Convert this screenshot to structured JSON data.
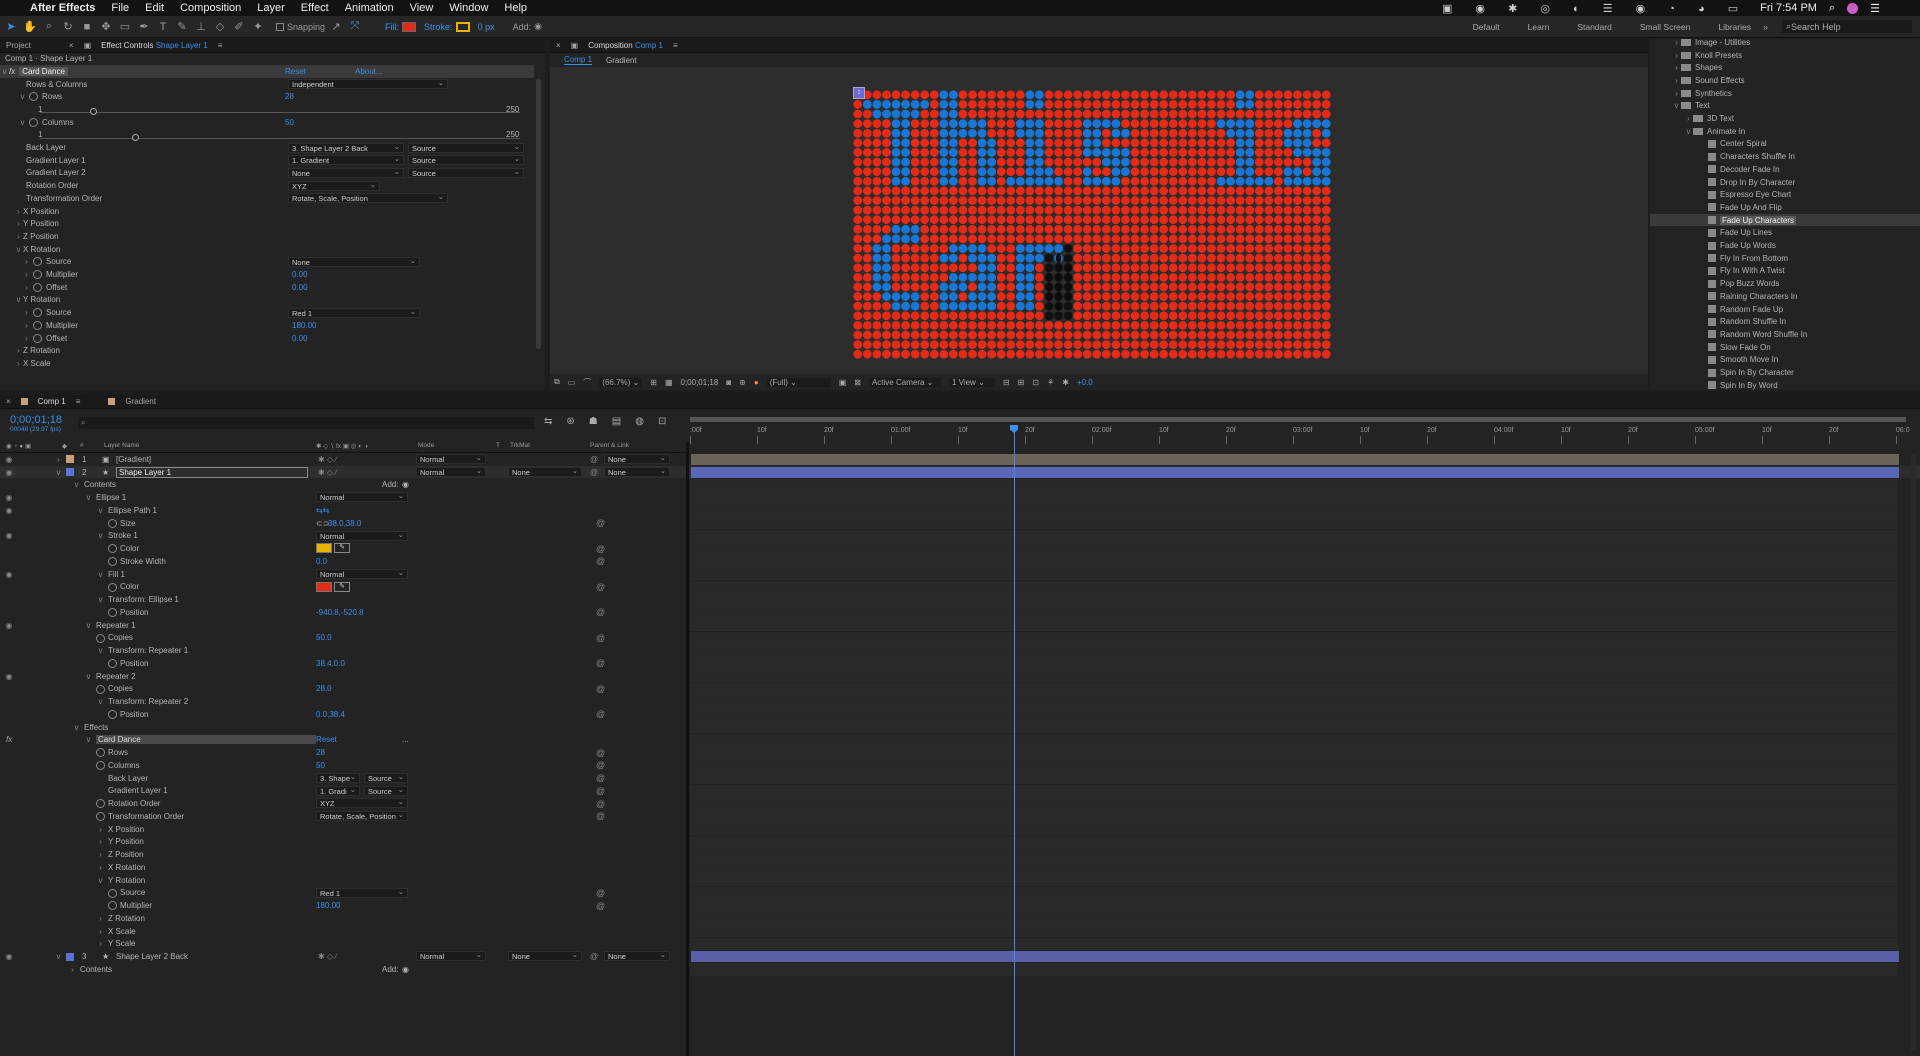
{
  "menubar": {
    "apple": "",
    "app": "After Effects",
    "items": [
      "File",
      "Edit",
      "Composition",
      "Layer",
      "Effect",
      "Animation",
      "View",
      "Window",
      "Help"
    ],
    "clock": "Fri 7:54 PM"
  },
  "toolbar": {
    "snapping": "Snapping",
    "fill": "Fill:",
    "stroke": "Stroke:",
    "stroke_px": "0 px",
    "add": "Add:",
    "fill_color": "#e52a18",
    "stroke_color": "#e8b400",
    "workspaces": [
      "Default",
      "Learn",
      "Standard",
      "Small Screen",
      "Libraries"
    ],
    "search": "Search Help"
  },
  "effect_panel": {
    "tab_project": "Project",
    "tab_effect": "Effect Controls",
    "tab_layer": "Shape Layer 1",
    "breadcrumb": "Comp 1 · Shape Layer 1",
    "effect_name": "Card Dance",
    "reset": "Reset",
    "about": "About...",
    "rows": [
      {
        "label": "Rows & Columns",
        "val": "Independent",
        "type": "dd"
      },
      {
        "label": "Rows",
        "val": "28",
        "type": "num",
        "tw": 1
      },
      {
        "label": "1",
        "val": "250",
        "type": "range"
      },
      {
        "label": "Columns",
        "val": "50",
        "type": "num",
        "tw": 1
      },
      {
        "label": "1",
        "val": "250",
        "type": "range2"
      },
      {
        "label": "Back Layer",
        "val": "3. Shape Layer 2 Back",
        "val2": "Source",
        "type": "dd2"
      },
      {
        "label": "Gradient Layer 1",
        "val": "1. Gradient",
        "val2": "Source",
        "type": "dd2"
      },
      {
        "label": "Gradient Layer 2",
        "val": "None",
        "val2": "Source",
        "type": "dd2"
      },
      {
        "label": "Rotation Order",
        "val": "XYZ",
        "type": "dds"
      },
      {
        "label": "Transformation Order",
        "val": "Rotate, Scale, Position",
        "type": "dd"
      },
      {
        "label": "X Position",
        "type": "grp"
      },
      {
        "label": "Y Position",
        "type": "grp"
      },
      {
        "label": "Z Position",
        "type": "grp"
      },
      {
        "label": "X Rotation",
        "type": "grpo"
      },
      {
        "label": "Source",
        "val": "None",
        "type": "ddi"
      },
      {
        "label": "Multiplier",
        "val": "0.00",
        "type": "numi"
      },
      {
        "label": "Offset",
        "val": "0.00",
        "type": "numi"
      },
      {
        "label": "Y Rotation",
        "type": "grpo"
      },
      {
        "label": "Source",
        "val": "Red 1",
        "type": "ddi"
      },
      {
        "label": "Multiplier",
        "val": "180.00",
        "type": "numi"
      },
      {
        "label": "Offset",
        "val": "0.00",
        "type": "numi"
      },
      {
        "label": "Z Rotation",
        "type": "grp"
      },
      {
        "label": "X Scale",
        "type": "grp"
      }
    ]
  },
  "comp_panel": {
    "title": "Composition",
    "comp": "Comp 1",
    "tab1": "Comp 1",
    "tab2": "Gradient",
    "text_line1": "This is a",
    "text_line2": "Car",
    "zoom": "(66.7%)",
    "time": "0;00;01;18",
    "res": "(Full)",
    "camera": "Active Camera",
    "view": "1 View",
    "exposure": "+0.0",
    "bg_dot": "#e52a18",
    "text_dot": "#1877d6"
  },
  "effects_panel": {
    "items": [
      {
        "label": "Image - Utilities",
        "lvl": 1,
        "kind": "folder"
      },
      {
        "label": "Knoll Presets",
        "lvl": 1,
        "kind": "folder"
      },
      {
        "label": "Shapes",
        "lvl": 1,
        "kind": "folder"
      },
      {
        "label": "Sound Effects",
        "lvl": 1,
        "kind": "folder"
      },
      {
        "label": "Synthetics",
        "lvl": 1,
        "kind": "folder"
      },
      {
        "label": "Text",
        "lvl": 1,
        "kind": "folder-open"
      },
      {
        "label": "3D Text",
        "lvl": 2,
        "kind": "folder"
      },
      {
        "label": "Animate In",
        "lvl": 2,
        "kind": "folder-open"
      },
      {
        "label": "Center Spiral",
        "lvl": 3,
        "kind": "preset"
      },
      {
        "label": "Characters Shuffle In",
        "lvl": 3,
        "kind": "preset"
      },
      {
        "label": "Decoder Fade In",
        "lvl": 3,
        "kind": "preset"
      },
      {
        "label": "Drop In By Character",
        "lvl": 3,
        "kind": "preset"
      },
      {
        "label": "Espresso Eye Chart",
        "lvl": 3,
        "kind": "preset"
      },
      {
        "label": "Fade Up And Flip",
        "lvl": 3,
        "kind": "preset"
      },
      {
        "label": "Fade Up Characters",
        "lvl": 3,
        "kind": "preset",
        "sel": true
      },
      {
        "label": "Fade Up Lines",
        "lvl": 3,
        "kind": "preset"
      },
      {
        "label": "Fade Up Words",
        "lvl": 3,
        "kind": "preset"
      },
      {
        "label": "Fly In From Bottom",
        "lvl": 3,
        "kind": "preset"
      },
      {
        "label": "Fly In With A Twist",
        "lvl": 3,
        "kind": "preset"
      },
      {
        "label": "Pop Buzz Words",
        "lvl": 3,
        "kind": "preset"
      },
      {
        "label": "Raining Characters In",
        "lvl": 3,
        "kind": "preset"
      },
      {
        "label": "Random Fade Up",
        "lvl": 3,
        "kind": "preset"
      },
      {
        "label": "Random Shuffle In",
        "lvl": 3,
        "kind": "preset"
      },
      {
        "label": "Random Word Shuffle In",
        "lvl": 3,
        "kind": "preset"
      },
      {
        "label": "Slow Fade On",
        "lvl": 3,
        "kind": "preset"
      },
      {
        "label": "Smooth Move In",
        "lvl": 3,
        "kind": "preset"
      },
      {
        "label": "Spin In By Character",
        "lvl": 3,
        "kind": "preset"
      },
      {
        "label": "Spin In By Word",
        "lvl": 3,
        "kind": "preset"
      }
    ]
  },
  "timeline": {
    "tab1": "Comp 1",
    "tab2": "Gradient",
    "timecode": "0;00;01;18",
    "frames": "00048 (29.97 fps)",
    "search_placeholder": "",
    "cols": {
      "layer_name": "Layer Name",
      "mode": "Mode",
      "t": "T",
      "trkmat": "TrkMat",
      "parent": "Parent & Link"
    },
    "ruler": [
      ":00f",
      "10f",
      "20f",
      "01:00f",
      "10f",
      "20f",
      "02:00f",
      "10f",
      "20f",
      "03:00f",
      "10f",
      "20f",
      "04:00f",
      "10f",
      "20f",
      "05:00f",
      "10f",
      "20f",
      "06:0"
    ],
    "layers": [
      {
        "num": "1",
        "name": "[Gradient]",
        "mode": "Normal",
        "trk": "",
        "parent": "None",
        "color": "#c9a07a",
        "bar": "#6b6459"
      },
      {
        "num": "2",
        "name": "Shape Layer 1",
        "mode": "Normal",
        "trk": "None",
        "parent": "None",
        "color": "#5a72d6",
        "bar": "#5a67b8",
        "sel": true
      },
      {
        "num": "3",
        "name": "Shape Layer 2 Back",
        "mode": "Normal",
        "trk": "None",
        "parent": "None",
        "color": "#5a72d6",
        "bar": "#5a5fa8"
      }
    ],
    "props": [
      {
        "label": "Contents",
        "ind": 0,
        "tw": "v",
        "add": "Add:"
      },
      {
        "label": "Ellipse 1",
        "ind": 1,
        "tw": "v",
        "val": "Normal",
        "vt": "dd",
        "eye": 1
      },
      {
        "label": "Ellipse Path 1",
        "ind": 2,
        "tw": "v",
        "icon": "path",
        "eye": 1
      },
      {
        "label": "Size",
        "ind": 3,
        "sw": 1,
        "val": "38.0,38.0",
        "vt": "link",
        "kf": 1
      },
      {
        "label": "Stroke 1",
        "ind": 2,
        "tw": "v",
        "val": "Normal",
        "vt": "dd",
        "eye": 1
      },
      {
        "label": "Color",
        "ind": 3,
        "sw": 1,
        "vt": "color",
        "cv": "#e8b400",
        "kf": 1
      },
      {
        "label": "Stroke Width",
        "ind": 3,
        "sw": 1,
        "val": "0.0",
        "vt": "num",
        "kf": 1
      },
      {
        "label": "Fill 1",
        "ind": 2,
        "tw": "v",
        "val": "Normal",
        "vt": "dd",
        "eye": 1
      },
      {
        "label": "Color",
        "ind": 3,
        "sw": 1,
        "vt": "color",
        "cv": "#e52a18",
        "kf": 1
      },
      {
        "label": "Transform: Ellipse 1",
        "ind": 2,
        "tw": "v"
      },
      {
        "label": "Position",
        "ind": 3,
        "sw": 1,
        "val": "-940.8,-520.8",
        "vt": "num",
        "kf": 1
      },
      {
        "label": "Repeater 1",
        "ind": 1,
        "tw": "v",
        "eye": 1
      },
      {
        "label": "Copies",
        "ind": 2,
        "sw": 1,
        "val": "50.0",
        "vt": "num",
        "kf": 1
      },
      {
        "label": "Transform: Repeater 1",
        "ind": 2,
        "tw": "v"
      },
      {
        "label": "Position",
        "ind": 3,
        "sw": 1,
        "val": "38.4,0.0",
        "vt": "num",
        "kf": 1
      },
      {
        "label": "Repeater 2",
        "ind": 1,
        "tw": "v",
        "eye": 1
      },
      {
        "label": "Copies",
        "ind": 2,
        "sw": 1,
        "val": "28.0",
        "vt": "num",
        "kf": 1
      },
      {
        "label": "Transform: Repeater 2",
        "ind": 2,
        "tw": "v"
      },
      {
        "label": "Position",
        "ind": 3,
        "sw": 1,
        "val": "0.0,38.4",
        "vt": "num",
        "kf": 1
      },
      {
        "label": "Effects",
        "ind": 0,
        "tw": "v"
      },
      {
        "label": "Card Dance",
        "ind": 1,
        "tw": "v",
        "val": "Reset",
        "vt": "link2",
        "fx": 1,
        "hl": 1,
        "dots": "..."
      },
      {
        "label": "Rows",
        "ind": 2,
        "sw": 1,
        "val": "28",
        "vt": "num",
        "kf": 1
      },
      {
        "label": "Columns",
        "ind": 2,
        "sw": 1,
        "val": "50",
        "vt": "num",
        "kf": 1
      },
      {
        "label": "Back Layer",
        "ind": 2,
        "val": "3. Shape",
        "val2": "Source",
        "vt": "dd2",
        "kf": 1
      },
      {
        "label": "Gradient Layer 1",
        "ind": 2,
        "val": "1. Gradi",
        "val2": "Source",
        "vt": "dd2",
        "kf": 1
      },
      {
        "label": "Rotation Order",
        "ind": 2,
        "sw": 1,
        "val": "XYZ",
        "vt": "dd",
        "kf": 1
      },
      {
        "label": "Transformation Order",
        "ind": 2,
        "sw": 1,
        "val": "Rotate, Scale, Position",
        "vt": "dd",
        "kf": 1
      },
      {
        "label": "X Position",
        "ind": 2,
        "tw": ">"
      },
      {
        "label": "Y Position",
        "ind": 2,
        "tw": ">"
      },
      {
        "label": "Z Position",
        "ind": 2,
        "tw": ">"
      },
      {
        "label": "X Rotation",
        "ind": 2,
        "tw": ">"
      },
      {
        "label": "Y Rotation",
        "ind": 2,
        "tw": "v"
      },
      {
        "label": "Source",
        "ind": 3,
        "sw": 1,
        "val": "Red 1",
        "vt": "dd",
        "kf": 1
      },
      {
        "label": "Multiplier",
        "ind": 3,
        "sw": 1,
        "val": "180.00",
        "vt": "num",
        "kf": 1
      },
      {
        "label": "Z Rotation",
        "ind": 2,
        "tw": ">"
      },
      {
        "label": "X Scale",
        "ind": 2,
        "tw": ">"
      },
      {
        "label": "Y Scale",
        "ind": 2,
        "tw": ">"
      }
    ],
    "contents2": "Contents",
    "add2": "Add:"
  }
}
